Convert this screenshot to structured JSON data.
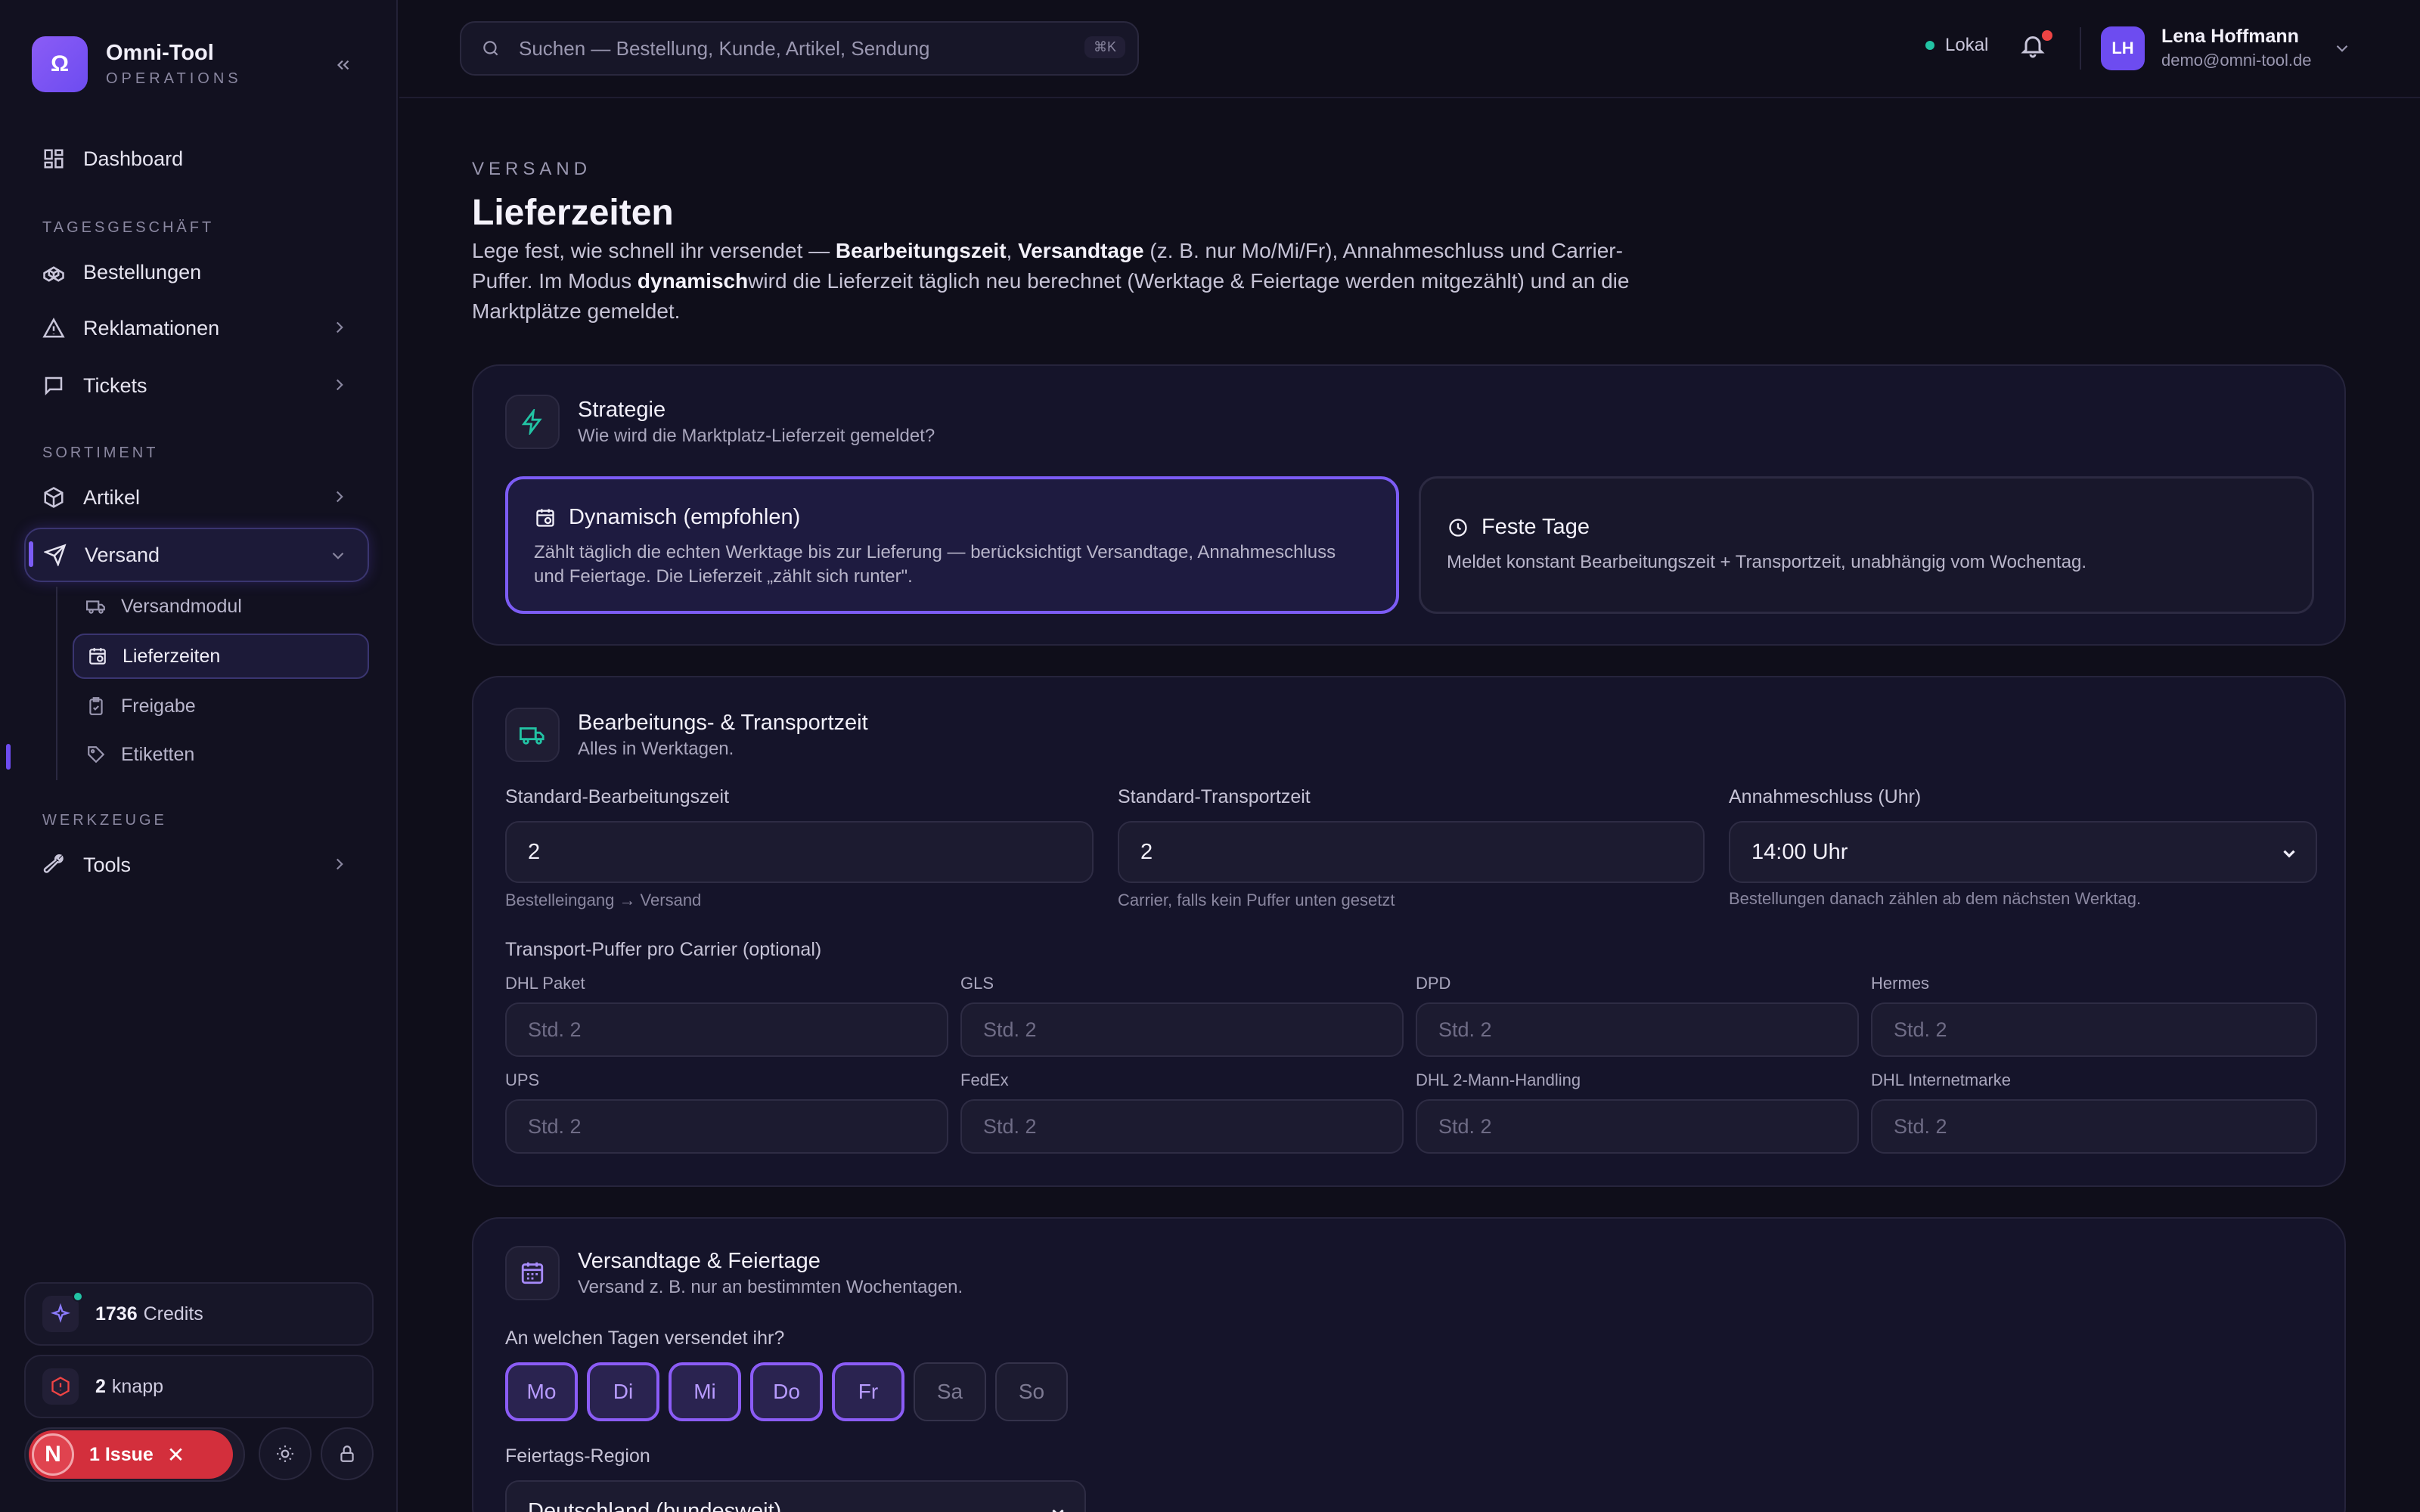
{
  "brand": {
    "name": "Omni-Tool",
    "sub": "OPERATIONS",
    "logo_glyph": "Ω"
  },
  "nav": {
    "dashboard": "Dashboard",
    "sections": {
      "tagesgeschaeft": "TAGESGESCHÄFT",
      "sortiment": "SORTIMENT",
      "werkzeuge": "WERKZEUGE"
    },
    "bestellungen": "Bestellungen",
    "reklamationen": "Reklamationen",
    "tickets": "Tickets",
    "artikel": "Artikel",
    "versand": "Versand",
    "sub": {
      "versandmodul": "Versandmodul",
      "lieferzeiten": "Lieferzeiten",
      "freigabe": "Freigabe",
      "etiketten": "Etiketten"
    },
    "tools": "Tools"
  },
  "sidebar_cards": {
    "credits_value": "1736",
    "credits_label": "Credits",
    "knapp_value": "2",
    "knapp_label": "knapp"
  },
  "issue": {
    "letter": "N",
    "label": "1 Issue"
  },
  "topbar": {
    "search_placeholder": "Suchen — Bestellung, Kunde, Artikel, Sendung",
    "shortcut": "⌘K",
    "status": "Lokal",
    "user_initials": "LH",
    "user_name": "Lena Hoffmann",
    "user_email": "demo@omni-tool.de"
  },
  "page": {
    "eyebrow": "VERSAND",
    "title": "Lieferzeiten",
    "intro_1": "Lege fest, wie schnell ihr versendet — ",
    "intro_b1": "Bearbeitungszeit",
    "intro_2": ", ",
    "intro_b2": "Versandtage",
    "intro_3": " (z. B. nur Mo/Mi/Fr), Annahmeschluss und Carrier-Puffer. Im Modus ",
    "intro_b3": "dynamisch",
    "intro_4": "wird die Lieferzeit täglich neu berechnet (Werktage & Feiertage werden mitgezählt) und an die Marktplätze gemeldet."
  },
  "strategy": {
    "title": "Strategie",
    "subtitle": "Wie wird die Marktplatz-Lieferzeit gemeldet?",
    "dynamic_title": "Dynamisch (empfohlen)",
    "dynamic_desc": "Zählt täglich die echten Werktage bis zur Lieferung — berücksichtigt Versandtage, Annahmeschluss und Feiertage. Die Lieferzeit „zählt sich runter\".",
    "fixed_title": "Feste Tage",
    "fixed_desc": "Meldet konstant Bearbeitungszeit + Transportzeit, unabhängig vom Wochentag."
  },
  "processing": {
    "title": "Bearbeitungs- & Transportzeit",
    "subtitle": "Alles in Werktagen.",
    "bearbeitung_label": "Standard-Bearbeitungszeit",
    "bearbeitung_value": "2",
    "bearbeitung_hint": "Bestelleingang → Versand",
    "transport_label": "Standard-Transportzeit",
    "transport_value": "2",
    "transport_hint": "Carrier, falls kein Puffer unten gesetzt",
    "annahme_label": "Annahmeschluss (Uhr)",
    "annahme_value": "14:00 Uhr",
    "annahme_hint": "Bestellungen danach zählen ab dem nächsten Werktag.",
    "puffer_label": "Transport-Puffer pro Carrier (optional)",
    "carriers": [
      {
        "name": "DHL Paket",
        "placeholder": "Std. 2"
      },
      {
        "name": "GLS",
        "placeholder": "Std. 2"
      },
      {
        "name": "DPD",
        "placeholder": "Std. 2"
      },
      {
        "name": "Hermes",
        "placeholder": "Std. 2"
      },
      {
        "name": "UPS",
        "placeholder": "Std. 2"
      },
      {
        "name": "FedEx",
        "placeholder": "Std. 2"
      },
      {
        "name": "DHL 2-Mann-Handling",
        "placeholder": "Std. 2"
      },
      {
        "name": "DHL Internetmarke",
        "placeholder": "Std. 2"
      }
    ]
  },
  "shipping_days": {
    "title": "Versandtage & Feiertage",
    "subtitle": "Versand z. B. nur an bestimmten Wochentagen.",
    "question": "An welchen Tagen versendet ihr?",
    "days": [
      {
        "label": "Mo",
        "on": true
      },
      {
        "label": "Di",
        "on": true
      },
      {
        "label": "Mi",
        "on": true
      },
      {
        "label": "Do",
        "on": true
      },
      {
        "label": "Fr",
        "on": true
      },
      {
        "label": "Sa",
        "on": false
      },
      {
        "label": "So",
        "on": false
      }
    ],
    "region_label": "Feiertags-Region",
    "region_value": "Deutschland (bundesweit)"
  },
  "colors": {
    "accent": "#7c5cf5",
    "teal": "#22c3a4",
    "danger": "#d32f3c",
    "bg": "#0f0e1a"
  }
}
